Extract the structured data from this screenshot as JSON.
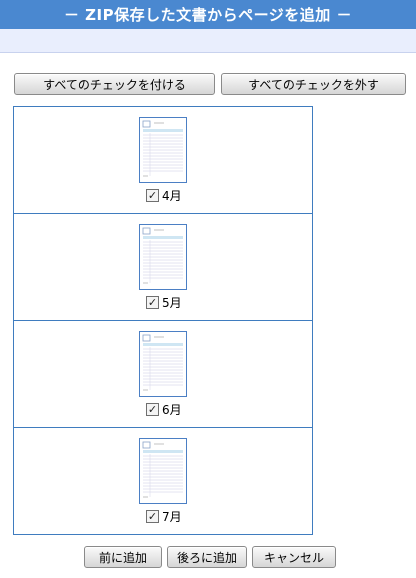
{
  "window": {
    "title": "－ ZIP保存した文書からページを追加 －"
  },
  "toolbar": {
    "check_all_label": "すべてのチェックを付ける",
    "uncheck_all_label": "すべてのチェックを外す"
  },
  "pages": [
    {
      "label": "4月",
      "checked": true
    },
    {
      "label": "5月",
      "checked": true
    },
    {
      "label": "6月",
      "checked": true
    },
    {
      "label": "7月",
      "checked": true
    }
  ],
  "footer": {
    "add_before_label": "前に追加",
    "add_after_label": "後ろに追加",
    "cancel_label": "キャンセル"
  },
  "colors": {
    "title_bar": "#4a88d0",
    "sub_bar": "#e9eefd",
    "border": "#3f7cbf"
  },
  "icons": {
    "checkbox": "check-mark"
  }
}
